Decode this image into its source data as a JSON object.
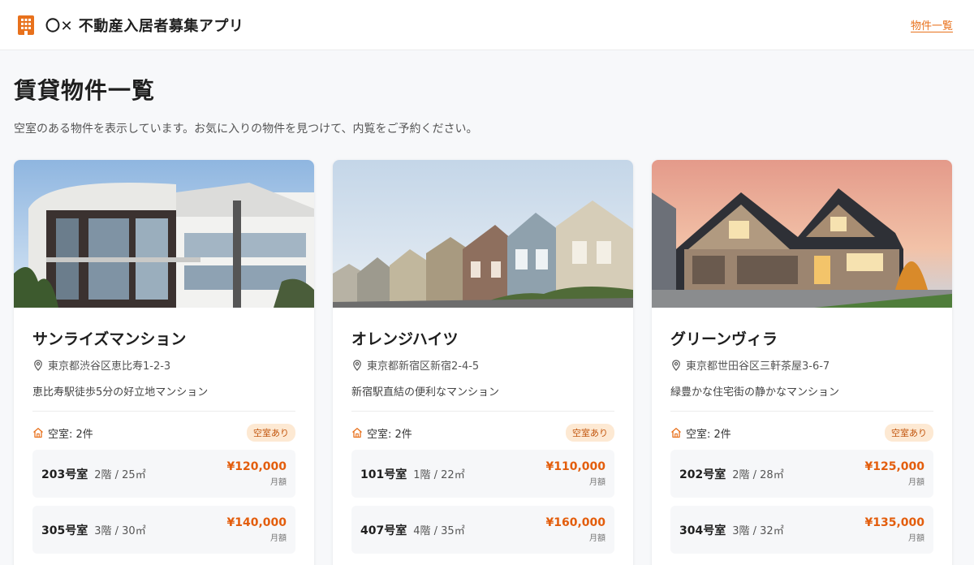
{
  "header": {
    "title": "〇✕ 不動産入居者募集アプリ",
    "nav_link": "物件一覧"
  },
  "page": {
    "title": "賃貸物件一覧",
    "description": "空室のある物件を表示しています。お気に入りの物件を見つけて、内覧をご予約ください。"
  },
  "properties": [
    {
      "name": "サンライズマンション",
      "address": "東京都渋谷区恵比寿1-2-3",
      "description": "恵比寿駅徒歩5分の好立地マンション",
      "vacancy": "空室: 2件",
      "badge": "空室あり",
      "rooms": [
        {
          "number": "203号室",
          "spec": "2階 / 25㎡",
          "price": "¥120,000",
          "price_label": "月額"
        },
        {
          "number": "305号室",
          "spec": "3階 / 30㎡",
          "price": "¥140,000",
          "price_label": "月額"
        }
      ]
    },
    {
      "name": "オレンジハイツ",
      "address": "東京都新宿区新宿2-4-5",
      "description": "新宿駅直結の便利なマンション",
      "vacancy": "空室: 2件",
      "badge": "空室あり",
      "rooms": [
        {
          "number": "101号室",
          "spec": "1階 / 22㎡",
          "price": "¥110,000",
          "price_label": "月額"
        },
        {
          "number": "407号室",
          "spec": "4階 / 35㎡",
          "price": "¥160,000",
          "price_label": "月額"
        }
      ]
    },
    {
      "name": "グリーンヴィラ",
      "address": "東京都世田谷区三軒茶屋3-6-7",
      "description": "緑豊かな住宅街の静かなマンション",
      "vacancy": "空室: 2件",
      "badge": "空室あり",
      "rooms": [
        {
          "number": "202号室",
          "spec": "2階 / 28㎡",
          "price": "¥125,000",
          "price_label": "月額"
        },
        {
          "number": "304号室",
          "spec": "3階 / 32㎡",
          "price": "¥135,000",
          "price_label": "月額"
        }
      ]
    }
  ],
  "icons": {
    "brand": "building-icon",
    "address": "map-pin-icon",
    "vacancy": "home-icon"
  },
  "colors": {
    "accent": "#e8711c",
    "price": "#e35d0c",
    "badge_bg": "#fde9d3",
    "badge_text": "#c2560e"
  }
}
